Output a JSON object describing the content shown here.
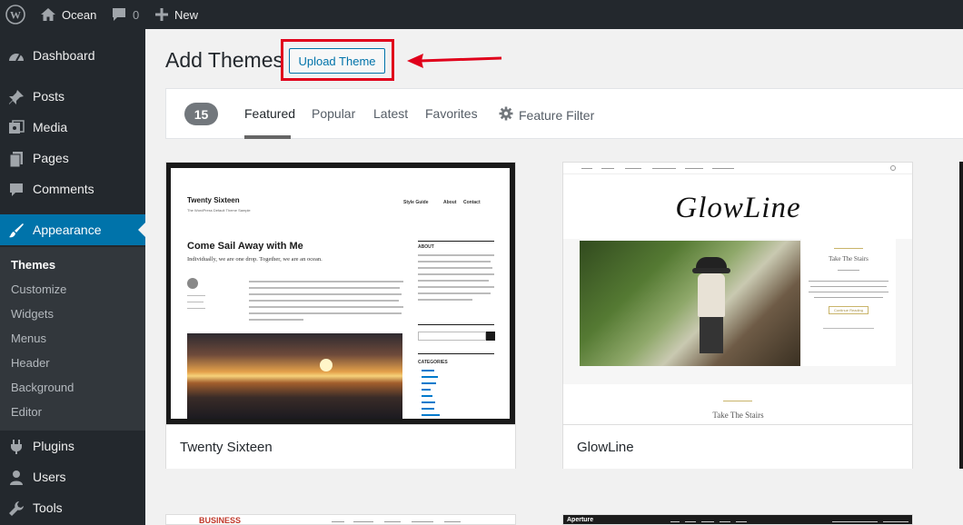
{
  "adminbar": {
    "site_name": "Ocean",
    "comments_count": "0",
    "new_label": "New"
  },
  "sidebar": {
    "items": [
      {
        "label": "Dashboard",
        "icon": "dashboard-icon"
      },
      {
        "label": "Posts",
        "icon": "pin-icon"
      },
      {
        "label": "Media",
        "icon": "media-icon"
      },
      {
        "label": "Pages",
        "icon": "pages-icon"
      },
      {
        "label": "Comments",
        "icon": "comment-icon"
      },
      {
        "label": "Appearance",
        "icon": "brush-icon"
      },
      {
        "label": "Plugins",
        "icon": "plugin-icon"
      },
      {
        "label": "Users",
        "icon": "user-icon"
      },
      {
        "label": "Tools",
        "icon": "wrench-icon"
      }
    ],
    "submenu": [
      "Themes",
      "Customize",
      "Widgets",
      "Menus",
      "Header",
      "Background",
      "Editor"
    ],
    "active_color": "#0073aa"
  },
  "page": {
    "title": "Add Themes",
    "upload_button": "Upload Theme",
    "highlight_color": "#e0001b"
  },
  "filter": {
    "count": "15",
    "tabs": [
      "Featured",
      "Popular",
      "Latest",
      "Favorites"
    ],
    "feature_filter": "Feature Filter"
  },
  "themes": [
    {
      "name": "Twenty Sixteen",
      "preview": {
        "site_title": "Twenty Sixteen",
        "tagline": "The WordPress Default Theme Sample",
        "nav": [
          "Style Guide",
          "About",
          "Contact"
        ],
        "headline": "Come Sail Away with Me",
        "subhead": "Individually, we are one drop. Together, we are an ocean.",
        "about": "ABOUT",
        "categories": "CATEGORIES"
      }
    },
    {
      "name": "GlowLine",
      "preview": {
        "logo": "GlowLine",
        "post_title": "Take The Stairs",
        "button": "Continue Reading",
        "caption": "Take The Stairs"
      }
    }
  ],
  "bottom_previews": {
    "left_logo": "BUSINESS",
    "right_logo": "Aperture"
  }
}
